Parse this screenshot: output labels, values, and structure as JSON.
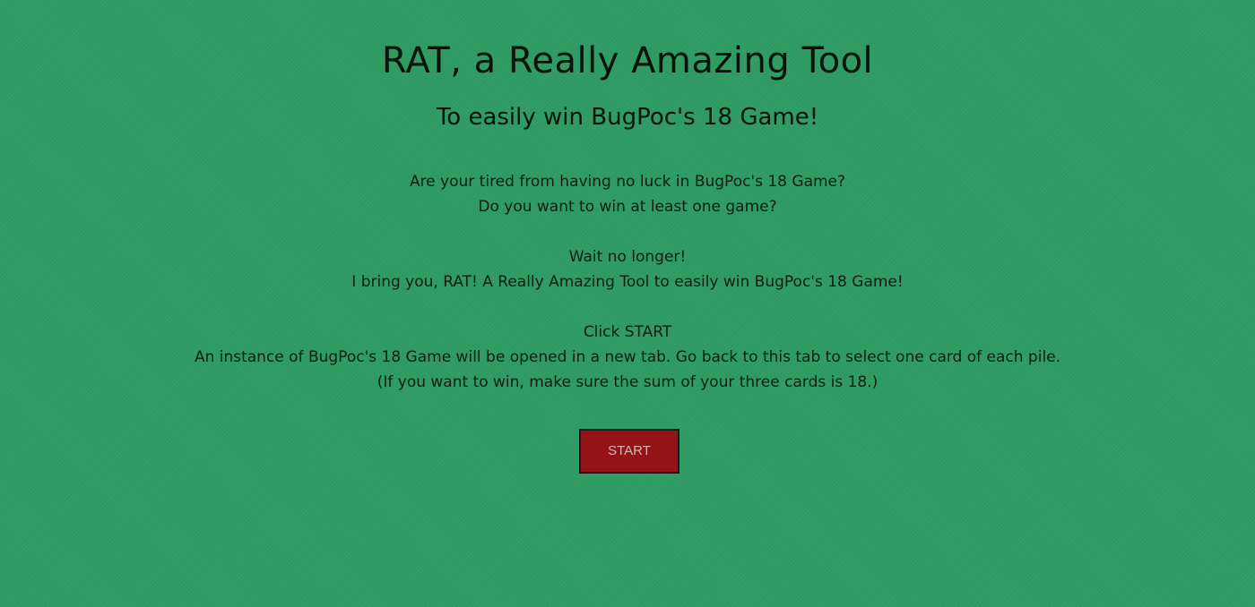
{
  "header": {
    "title": "RAT, a Really Amazing Tool",
    "subtitle": "To easily win BugPoc's 18 Game!"
  },
  "intro": {
    "line1": "Are your tired from having no luck in BugPoc's 18 Game?",
    "line2": "Do you want to win at least one game?"
  },
  "pitch": {
    "line1": "Wait no longer!",
    "line2": "I bring you, RAT! A Really Amazing Tool to easily win BugPoc's 18 Game!"
  },
  "instructions": {
    "line1": "Click START",
    "line2": "An instance of BugPoc's 18 Game will be opened in a new tab. Go back to this tab to select one card of each pile.",
    "line3": "(If you want to win, make sure the sum of your three cards is 18.)"
  },
  "start_button": {
    "label": "START"
  },
  "colors": {
    "background": "#2f9c63",
    "button": "#931318",
    "button_text": "#d9b3b3"
  }
}
